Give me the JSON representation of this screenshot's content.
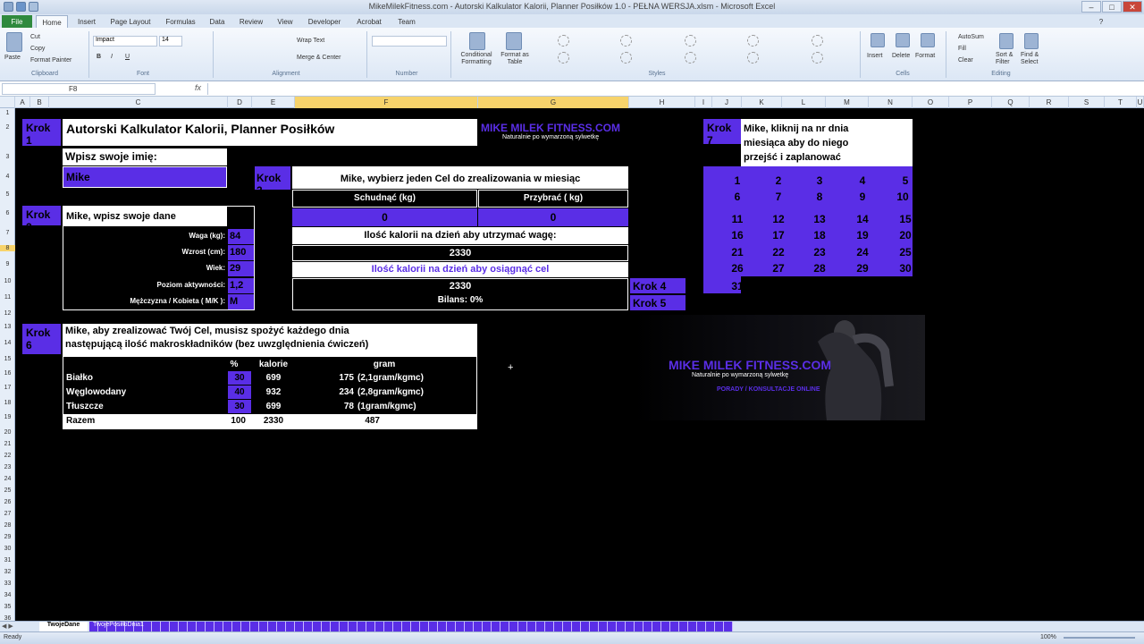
{
  "window": {
    "title": "MikeMilekFitness.com - Autorski Kalkulator Kalorii, Planner Posiłków 1.0 - PEŁNA WERSJA.xlsm - Microsoft Excel"
  },
  "ribbon_tabs": [
    "File",
    "Home",
    "Insert",
    "Page Layout",
    "Formulas",
    "Data",
    "Review",
    "View",
    "Developer",
    "Acrobat",
    "Team"
  ],
  "clipboard": {
    "paste": "Paste",
    "cut": "Cut",
    "copy": "Copy",
    "format_painter": "Format Painter",
    "group": "Clipboard"
  },
  "font": {
    "name": "Impact",
    "size": "14",
    "group": "Font"
  },
  "alignment": {
    "wrap": "Wrap Text",
    "merge": "Merge & Center",
    "group": "Alignment"
  },
  "number": {
    "group": "Number"
  },
  "styles": {
    "conditional": "Conditional Formatting",
    "format_table": "Format as Table",
    "group": "Styles"
  },
  "cells": {
    "insert": "Insert",
    "delete": "Delete",
    "format": "Format",
    "group": "Cells"
  },
  "editing": {
    "autosum": "AutoSum",
    "fill": "Fill",
    "clear": "Clear",
    "sort": "Sort & Filter",
    "find": "Find & Select",
    "group": "Editing"
  },
  "formula_bar": {
    "name_box": "F8",
    "fx": "fx",
    "value": ""
  },
  "columns": [
    "A",
    "B",
    "C",
    "D",
    "E",
    "F",
    "G",
    "H",
    "I",
    "J",
    "K",
    "L",
    "M",
    "N",
    "O",
    "P",
    "Q",
    "R",
    "S",
    "T",
    "U"
  ],
  "rows": [
    "1",
    "2",
    "3",
    "4",
    "5",
    "6",
    "7",
    "8",
    "9",
    "10",
    "11",
    "12",
    "13",
    "14",
    "15",
    "16",
    "17",
    "18",
    "19",
    "20",
    "21",
    "22",
    "23",
    "24",
    "25",
    "26",
    "27",
    "28",
    "29",
    "30",
    "31",
    "32",
    "33",
    "34",
    "35",
    "36"
  ],
  "sheet": {
    "step1": "Krok 1",
    "title": "Autorski Kalkulator Kalorii, Planner Posiłków",
    "brand": "MIKE MILEK FITNESS.COM",
    "brand_tagline": "Naturalnie po wymarzoną sylwetkę",
    "name_label": "Wpisz swoje imię:",
    "name_value": "Mike",
    "step2": "Krok 2",
    "data_label": "Mike, wpisz swoje dane",
    "fields": [
      {
        "label": "Waga (kg):",
        "value": "84"
      },
      {
        "label": "Wzrost (cm):",
        "value": "180"
      },
      {
        "label": "Wiek:",
        "value": "29"
      },
      {
        "label": "Poziom aktywności:",
        "value": "1,2"
      },
      {
        "label": "Mężczyzna / Kobieta ( M/K ):",
        "value": "M"
      }
    ],
    "step3": "Krok 3",
    "goal_label": "Mike, wybierz jeden Cel do zrealizowania w miesiąc",
    "lose_label": "Schudnąć (kg)",
    "gain_label": "Przybrać ( kg)",
    "lose_value": "0",
    "gain_value": "0",
    "maintain_label": "Ilość kalorii na dzień aby utrzymać wagę:",
    "maintain_value": "2330",
    "target_label": "Ilość kalorii na dzień aby osiągnąć cel",
    "target_value": "2330",
    "balance": "Bilans:  0%",
    "step4": "Krok 4",
    "step5": "Krok 5",
    "step6": "Krok 6",
    "macro_label_1": "Mike, aby zrealizować Twój Cel, musisz spożyć każdego dnia",
    "macro_label_2": "następującą ilość makroskładników (bez uwzględnienia ćwiczeń)",
    "macro_headers": {
      "pct": "%",
      "kcal": "kalorie",
      "gram": "gram"
    },
    "macros": [
      {
        "name": "Białko",
        "pct": "30",
        "kcal": "699",
        "gram": "175",
        "note": "(2,1gram/kgmc)"
      },
      {
        "name": "Węglowodany",
        "pct": "40",
        "kcal": "932",
        "gram": "234",
        "note": "(2,8gram/kgmc)"
      },
      {
        "name": "Tłuszcze",
        "pct": "30",
        "kcal": "699",
        "gram": "78",
        "note": "(1gram/kgmc)"
      }
    ],
    "total": {
      "name": "Razem",
      "pct": "100",
      "kcal": "2330",
      "gram": "487"
    },
    "step7": "Krok 7",
    "calendar_label": "Mike, kliknij na nr dnia miesiąca aby do niego przejść i zaplanować posiłki",
    "days": [
      "1",
      "2",
      "3",
      "4",
      "5",
      "6",
      "7",
      "8",
      "9",
      "10",
      "11",
      "12",
      "13",
      "14",
      "15",
      "16",
      "17",
      "18",
      "19",
      "20",
      "21",
      "22",
      "23",
      "24",
      "25",
      "26",
      "27",
      "28",
      "29",
      "30",
      "31"
    ],
    "logo_brand": "MIKE MILEK FITNESS.COM",
    "logo_tagline": "Naturalnie po wymarzoną sylwetkę",
    "logo_sub": "PORADY / KONSULTACJE ONLINE"
  },
  "sheet_tabs": [
    "TwojeDane",
    "TwojePosiłkiDnia1"
  ],
  "status": {
    "ready": "Ready",
    "zoom": "100%"
  },
  "colors": {
    "accent": "#5a2ee6",
    "background": "#000000"
  }
}
